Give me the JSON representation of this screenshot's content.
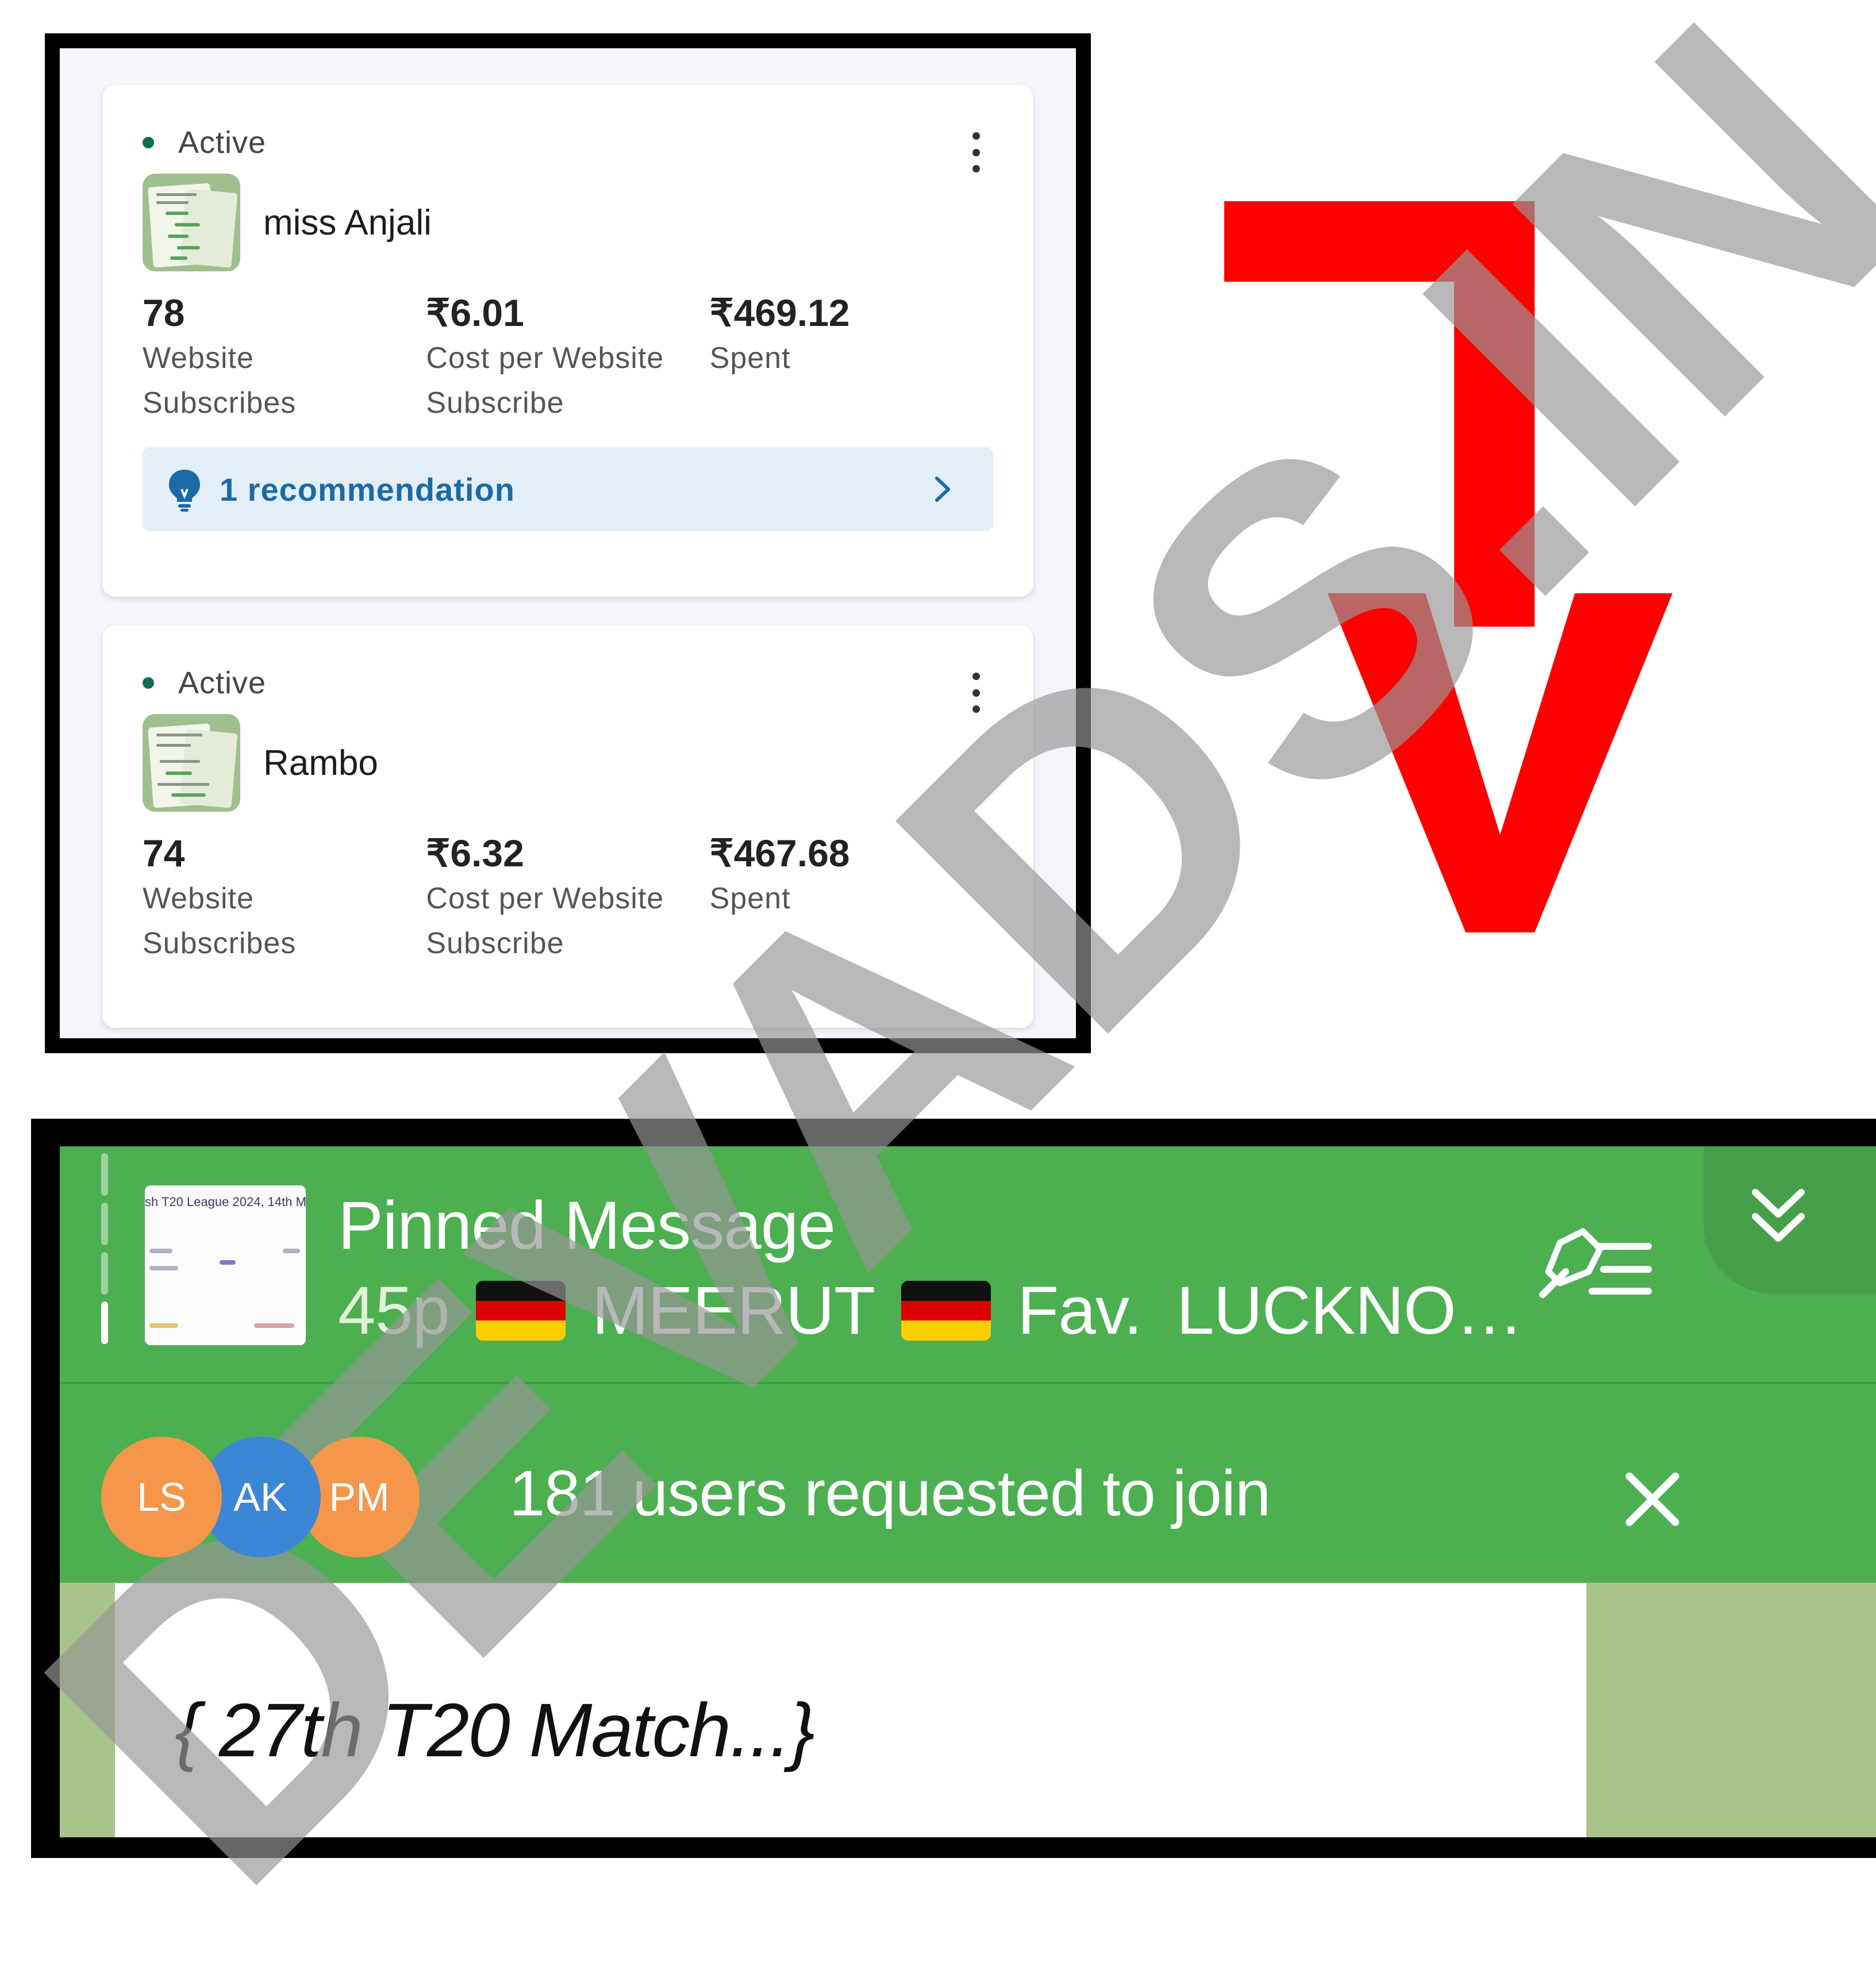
{
  "campaigns": [
    {
      "status": "Active",
      "name": "miss Anjali",
      "metrics": [
        {
          "value": "78",
          "label": "Website Subscribes"
        },
        {
          "value": "₹6.01",
          "label": "Cost per Website Subscribe"
        },
        {
          "value": "₹469.12",
          "label": "Spent"
        }
      ],
      "recommendation": "1 recommendation"
    },
    {
      "status": "Active",
      "name": "Rambo",
      "metrics": [
        {
          "value": "74",
          "label": "Website Subscribes"
        },
        {
          "value": "₹6.32",
          "label": "Cost per Website Subscribe"
        },
        {
          "value": "₹467.68",
          "label": "Spent"
        }
      ]
    }
  ],
  "telegram": {
    "pinned_title": "Pinned Message",
    "pinned_thumb_caption": "sh T20 League 2024, 14th M",
    "pinned_preview": {
      "part1": "45p",
      "team1": "MEERUT",
      "fav": "Fav.",
      "team2": "LUCKNO…"
    },
    "avatars": [
      "LS",
      "AK",
      "PM"
    ],
    "join_text": "181 users requested to join",
    "message_text": "{  27th T20 Match...}"
  },
  "logo": {
    "letters": "TV",
    "color": "#ff0000"
  },
  "watermark": "DEVADS.IN",
  "colors": {
    "telegram_green": "#4caf50",
    "status_dot": "#0f6e55",
    "recommendation_bg": "#e4eef7",
    "recommendation_text": "#1a6aa8",
    "avatar_orange": "#f5964a",
    "avatar_blue": "#3c86d6"
  }
}
